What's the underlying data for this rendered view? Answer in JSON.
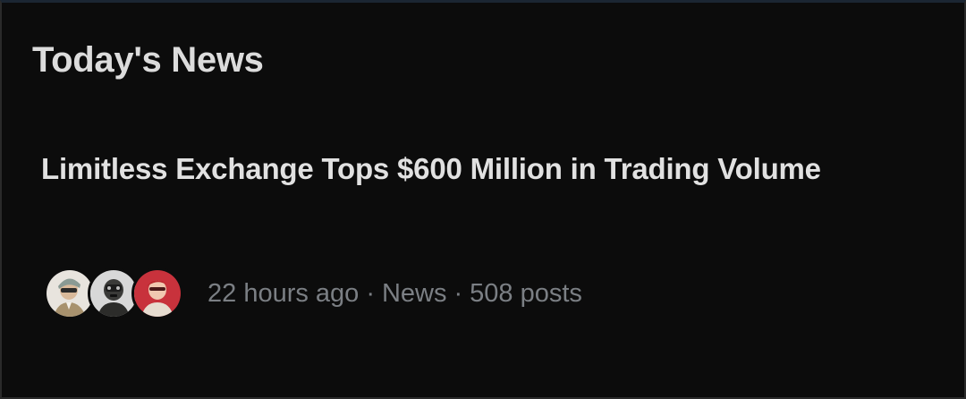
{
  "section": {
    "title": "Today's News"
  },
  "story": {
    "headline": "Limitless Exchange Tops $600 Million in Trading Volume",
    "time": "22 hours ago",
    "category": "News",
    "posts": "508 posts",
    "separator": "·"
  },
  "avatars": [
    {
      "name": "avatar-1",
      "bg": "#e8e4de"
    },
    {
      "name": "avatar-2",
      "bg": "#d8d8d8"
    },
    {
      "name": "avatar-3",
      "bg": "#c8323c"
    }
  ],
  "colors": {
    "background": "#0c0c0c",
    "title": "#dcdcdc",
    "headline": "#e1e1e1",
    "meta": "#7b7f84"
  }
}
